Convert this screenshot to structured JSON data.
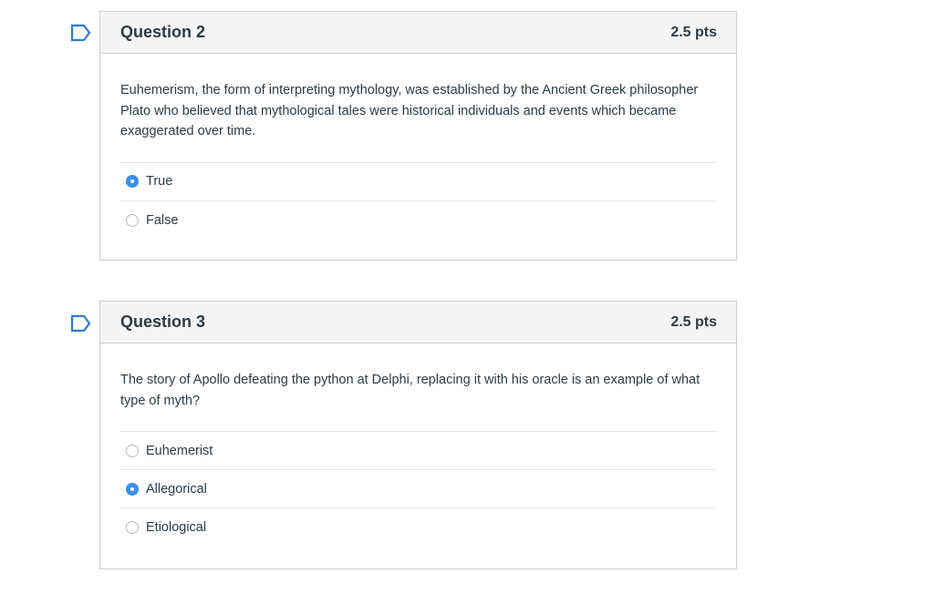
{
  "colors": {
    "flag_outline": "#2d7dd2",
    "radio_selected": "#3c8fe3",
    "header_bg": "#f5f5f5",
    "border": "#c7cdd1",
    "text": "#2d3b45"
  },
  "questions": [
    {
      "title": "Question 2",
      "points": "2.5 pts",
      "flag_icon": "flag-outline-icon",
      "text": "Euhemerism, the form of interpreting mythology, was established by the Ancient Greek philosopher Plato who believed that mythological tales were historical individuals and events which became exaggerated over time.",
      "answers": [
        {
          "label": "True",
          "selected": true
        },
        {
          "label": "False",
          "selected": false
        }
      ]
    },
    {
      "title": "Question 3",
      "points": "2.5 pts",
      "flag_icon": "flag-outline-icon",
      "text": "The story of Apollo defeating the python at Delphi, replacing it with his oracle is an example of what type of myth?",
      "answers": [
        {
          "label": "Euhemerist",
          "selected": false
        },
        {
          "label": "Allegorical",
          "selected": true
        },
        {
          "label": "Etiological",
          "selected": false
        }
      ]
    }
  ]
}
